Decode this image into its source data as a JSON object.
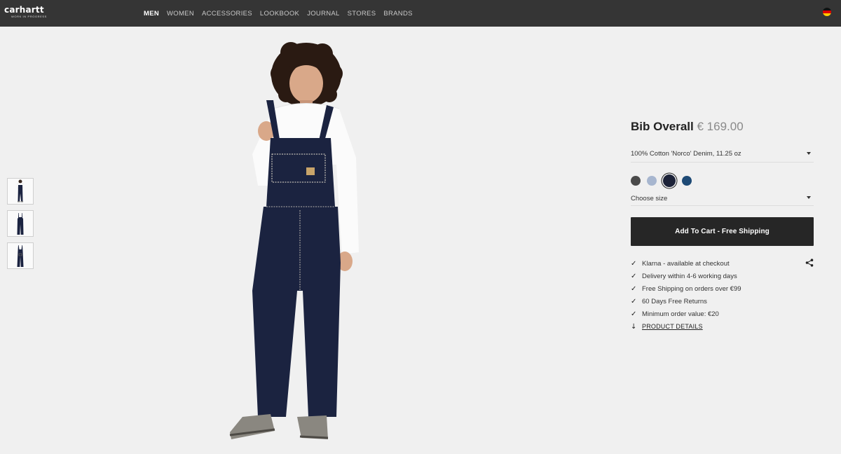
{
  "header": {
    "logo": "carhartt",
    "logo_sub": "WORK IN PROGRESS",
    "nav": [
      "MEN",
      "WOMEN",
      "ACCESSORIES",
      "LOOKBOOK",
      "JOURNAL",
      "STORES",
      "BRANDS"
    ],
    "active_nav": "MEN",
    "locale_flag": "germany-flag-icon"
  },
  "product": {
    "title": "Bib Overall",
    "price": "€ 169.00",
    "material": "100% Cotton 'Norco' Denim, 11.25 oz",
    "swatches": [
      {
        "color": "#4a4a4a"
      },
      {
        "color": "#a7b6cf"
      },
      {
        "color": "#1c2238",
        "selected": true
      },
      {
        "color": "#1e4a75"
      }
    ],
    "size_placeholder": "Choose size",
    "cart_button": "Add To Cart - Free Shipping",
    "features": [
      "Klarna - available at checkout",
      "Delivery within 4-6 working days",
      "Free Shipping on orders over €99",
      "60 Days Free Returns",
      "Minimum order value: €20"
    ],
    "details_link": "PRODUCT DETAILS"
  },
  "icons": {
    "check": "✓",
    "arrow_down": "↓"
  }
}
